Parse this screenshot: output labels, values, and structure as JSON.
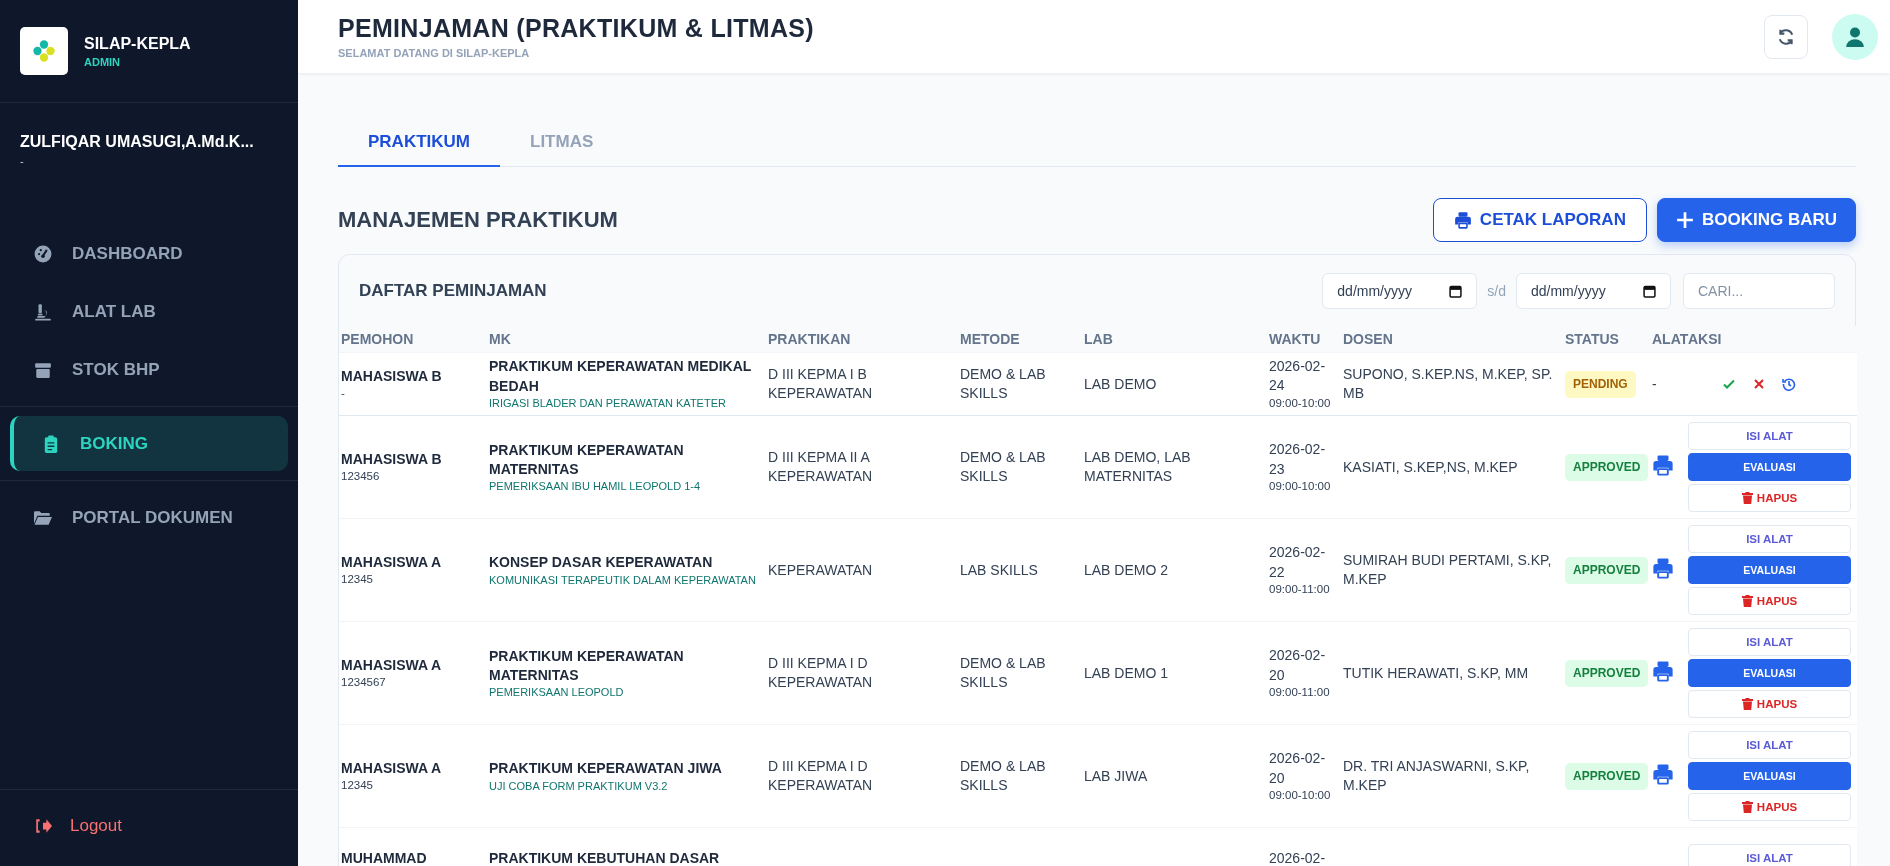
{
  "sidebar": {
    "app_name": "SILAP-KEPLA",
    "role": "ADMIN",
    "user_name": "ZULFIQAR UMASUGI,A.Md.K...",
    "user_sub": "-",
    "groups": [
      {
        "items": [
          {
            "label": "DASHBOARD",
            "kind": "gauge",
            "selected": false
          },
          {
            "label": "ALAT LAB",
            "kind": "microscope",
            "selected": false
          },
          {
            "label": "STOK BHP",
            "kind": "box",
            "selected": false
          }
        ]
      },
      {
        "items": [
          {
            "label": "BOKING",
            "kind": "clipboard",
            "selected": true
          }
        ]
      },
      {
        "items": [
          {
            "label": "PORTAL DOKUMEN",
            "kind": "folder",
            "selected": false
          }
        ]
      }
    ],
    "logout": "Logout"
  },
  "header": {
    "title": "PEMINJAMAN (PRAKTIKUM & LITMAS)",
    "subtitle": "SELAMAT DATANG DI SILAP-KEPLA"
  },
  "tabs": [
    {
      "label": "PRAKTIKUM",
      "selected": true
    },
    {
      "label": "LITMAS",
      "selected": false
    }
  ],
  "section": {
    "title": "MANAJEMEN PRAKTIKUM",
    "buttons": [
      {
        "label": "CETAK LAPORAN",
        "kind": "outline"
      },
      {
        "label": "BOOKING BARU",
        "kind": "primary"
      }
    ]
  },
  "table": {
    "title": "DAFTAR PEMINJAMAN",
    "date_from": {
      "placeholder": "dd/mm/yyyy"
    },
    "separator": "s/d",
    "date_to": {
      "placeholder": "dd/mm/yyyy"
    },
    "search": {
      "placeholder": "CARI..."
    },
    "columns": [
      "PEMOHON",
      "MK",
      "PRAKTIKAN",
      "METODE",
      "LAB",
      "WAKTU",
      "DOSEN",
      "STATUS",
      "ALAT",
      "AKSI"
    ],
    "rows": [
      {
        "pemohon": "MAHASISWA B",
        "pemohon_id": "-",
        "mk": "PRAKTIKUM KEPERAWATAN MEDIKAL BEDAH",
        "topic": "IRIGASI BLADER DAN PERAWATAN KATETER",
        "praktikan": "D III KEPMA I B KEPERAWATAN",
        "metode": "DEMO & LAB SKILLS",
        "lab": "LAB DEMO",
        "date": "2026-02-24",
        "time": "09:00-10:00",
        "dosen": "SUPONO, S.KEP.NS, M.KEP, SP. MB",
        "status": {
          "label": "PENDING",
          "kind": "pending"
        },
        "alat": {
          "kind": "text",
          "text": "-"
        },
        "actions": [
          {
            "kind": "approve"
          },
          {
            "kind": "reject"
          },
          {
            "kind": "history"
          }
        ]
      },
      {
        "pemohon": "MAHASISWA B",
        "pemohon_id": "123456",
        "mk": "PRAKTIKUM KEPERAWATAN MATERNITAS",
        "topic": "PEMERIKSAAN IBU HAMIL LEOPOLD 1-4",
        "praktikan": "D III KEPMA II A KEPERAWATAN",
        "metode": "DEMO & LAB SKILLS",
        "lab": "LAB DEMO, LAB MATERNITAS",
        "date": "2026-02-23",
        "time": "09:00-10:00",
        "dosen": "KASIATI, S.KEP,NS, M.KEP",
        "status": {
          "label": "APPROVED",
          "kind": "approved"
        },
        "alat": {
          "kind": "print"
        },
        "actions": [
          {
            "kind": "isi",
            "label": "ISI ALAT"
          },
          {
            "kind": "evaluasi",
            "label": "EVALUASI"
          },
          {
            "kind": "hapus",
            "label": "HAPUS"
          }
        ]
      },
      {
        "pemohon": "MAHASISWA A",
        "pemohon_id": "12345",
        "mk": "KONSEP DASAR KEPERAWATAN",
        "topic": "KOMUNIKASI TERAPEUTIK DALAM KEPERAWATAN",
        "praktikan": "KEPERAWATAN",
        "metode": "LAB SKILLS",
        "lab": "LAB DEMO 2",
        "date": "2026-02-22",
        "time": "09:00-11:00",
        "dosen": "SUMIRAH BUDI PERTAMI, S.KP, M.KEP",
        "status": {
          "label": "APPROVED",
          "kind": "approved"
        },
        "alat": {
          "kind": "print"
        },
        "actions": [
          {
            "kind": "isi",
            "label": "ISI ALAT"
          },
          {
            "kind": "evaluasi",
            "label": "EVALUASI"
          },
          {
            "kind": "hapus",
            "label": "HAPUS"
          }
        ]
      },
      {
        "pemohon": "MAHASISWA A",
        "pemohon_id": "1234567",
        "mk": "PRAKTIKUM KEPERAWATAN MATERNITAS",
        "topic": "PEMERIKSAAN LEOPOLD",
        "praktikan": "D III KEPMA I D KEPERAWATAN",
        "metode": "DEMO & LAB SKILLS",
        "lab": "LAB DEMO 1",
        "date": "2026-02-20",
        "time": "09:00-11:00",
        "dosen": "TUTIK HERAWATI, S.KP, MM",
        "status": {
          "label": "APPROVED",
          "kind": "approved"
        },
        "alat": {
          "kind": "print"
        },
        "actions": [
          {
            "kind": "isi",
            "label": "ISI ALAT"
          },
          {
            "kind": "evaluasi",
            "label": "EVALUASI"
          },
          {
            "kind": "hapus",
            "label": "HAPUS"
          }
        ]
      },
      {
        "pemohon": "MAHASISWA A",
        "pemohon_id": "12345",
        "mk": "PRAKTIKUM KEPERAWATAN JIWA",
        "topic": "UJI COBA FORM PRAKTIKUM V3.2",
        "praktikan": "D III KEPMA I D KEPERAWATAN",
        "metode": "DEMO & LAB SKILLS",
        "lab": "LAB JIWA",
        "date": "2026-02-20",
        "time": "09:00-10:00",
        "dosen": "DR. TRI ANJASWARNI, S.KP, M.KEP",
        "status": {
          "label": "APPROVED",
          "kind": "approved"
        },
        "alat": {
          "kind": "print"
        },
        "actions": [
          {
            "kind": "isi",
            "label": "ISI ALAT"
          },
          {
            "kind": "evaluasi",
            "label": "EVALUASI"
          },
          {
            "kind": "hapus",
            "label": "HAPUS"
          }
        ]
      },
      {
        "pemohon": "MUHAMMAD",
        "mk": "PRAKTIKUM KEBUTUHAN DASAR",
        "date": "2026-02-",
        "actions": [
          {
            "kind": "isi",
            "label": "ISI ALAT"
          }
        ]
      }
    ]
  }
}
